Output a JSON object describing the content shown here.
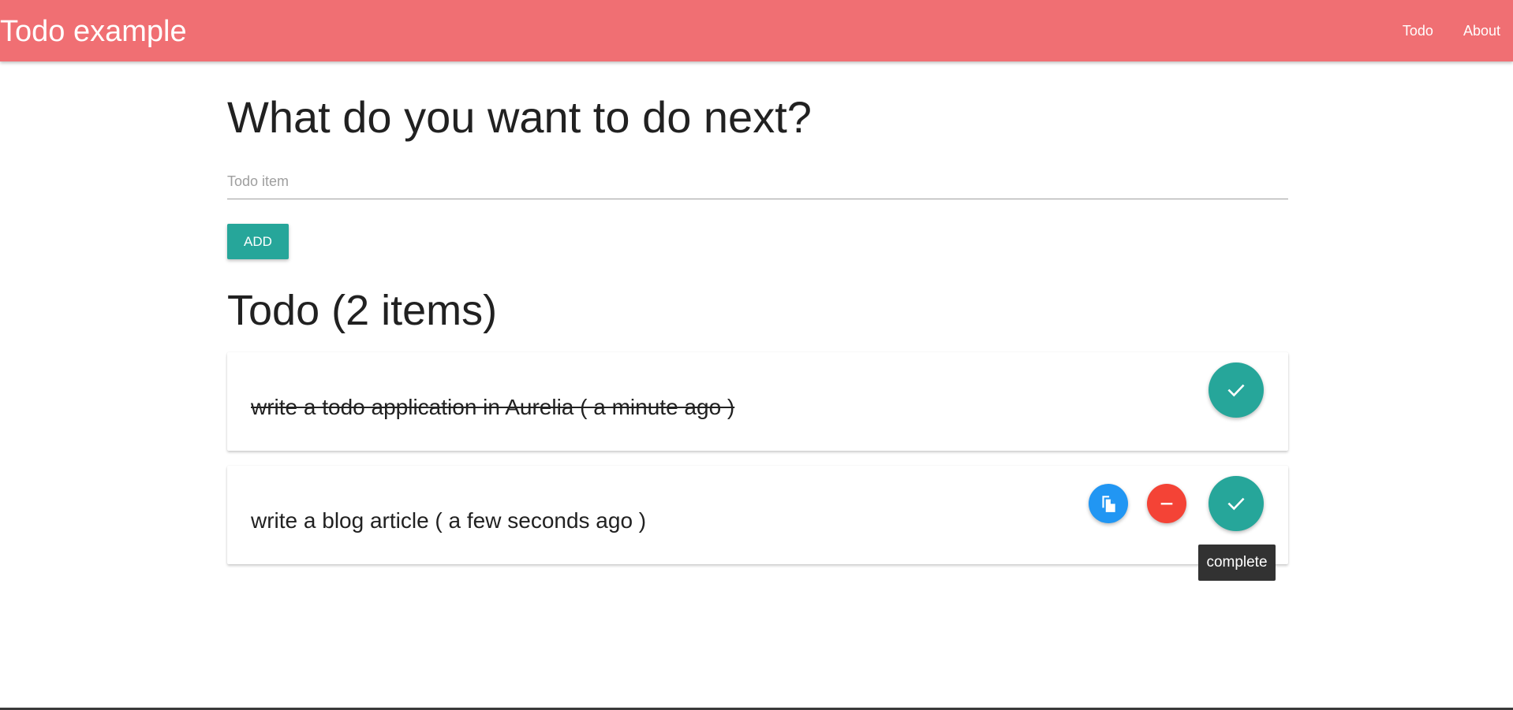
{
  "navbar": {
    "brand": "Todo example",
    "links": [
      "Todo",
      "About"
    ]
  },
  "form": {
    "heading": "What do you want to do next?",
    "input_placeholder": "Todo item",
    "input_value": "",
    "add_label": "ADD"
  },
  "list": {
    "title": "Todo (2 items)",
    "items": [
      {
        "text": "write a todo application in Aurelia ( a minute ago )",
        "completed": true
      },
      {
        "text": "write a blog article ( a few seconds ago )",
        "completed": false
      }
    ]
  },
  "tooltip": {
    "text": "complete"
  },
  "icons": {
    "complete": "check-icon",
    "copy": "copy-icon",
    "remove": "minus-icon"
  },
  "colors": {
    "navbar": "#f06f73",
    "primary": "#26a69a",
    "copy": "#2196f3",
    "remove": "#f44336",
    "tooltip": "#323232"
  }
}
